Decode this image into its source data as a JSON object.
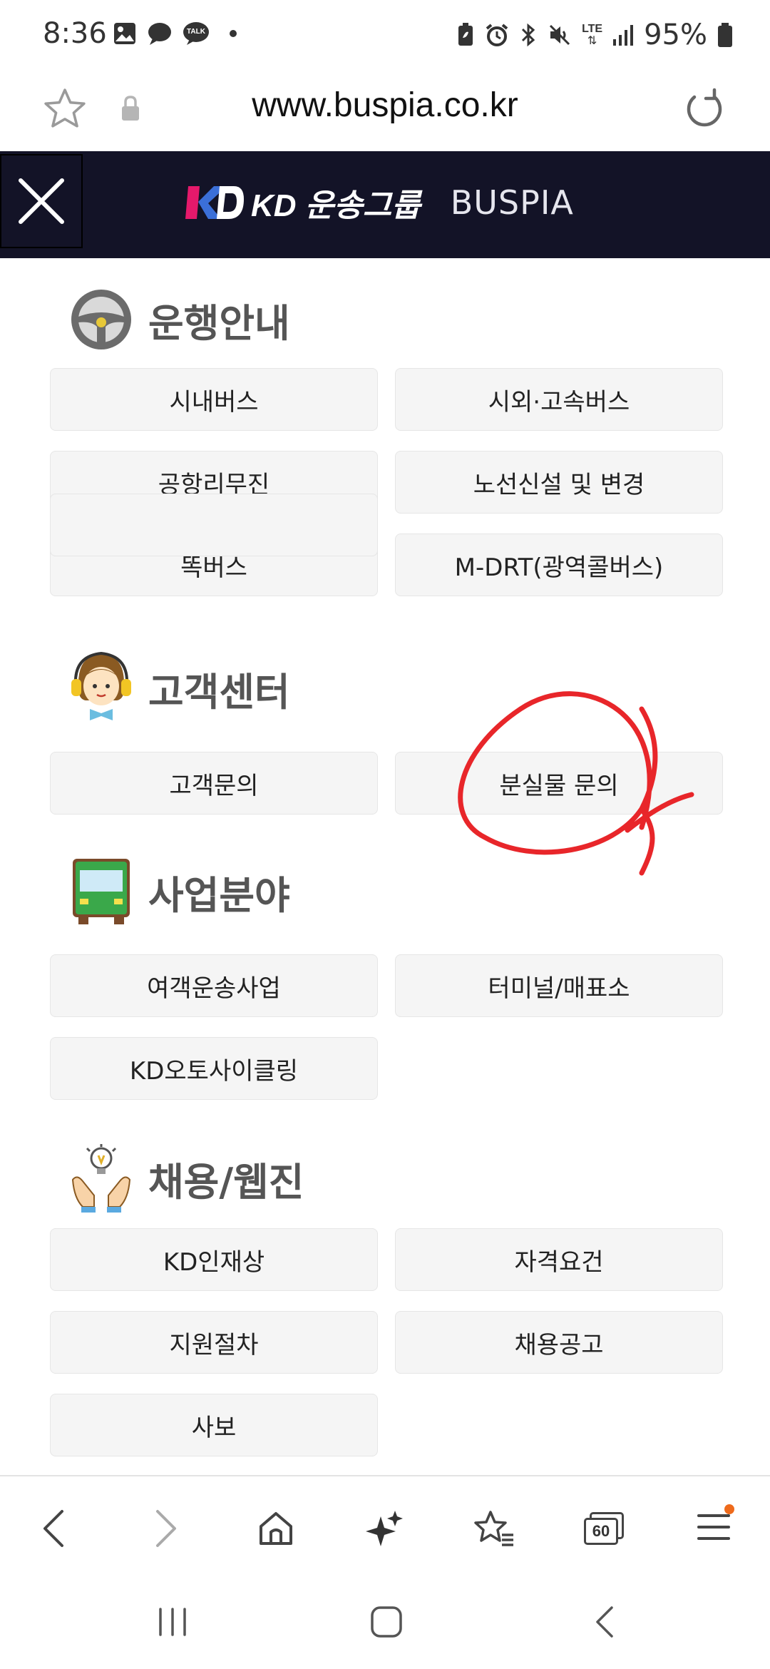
{
  "status_bar": {
    "time": "8:36",
    "talk_badge": "TALK",
    "network": "LTE",
    "battery": "95%"
  },
  "url_bar": {
    "url": "www.buspia.co.kr"
  },
  "header": {
    "logo_text": "KD 운송그룹",
    "logo_sub": "BUSPIA",
    "background": "#131327"
  },
  "sections": {
    "operation": {
      "title": "운행안내",
      "buttons": [
        "시내버스",
        "시외·고속버스",
        "공항리무진",
        "노선신설 및 변경",
        "똑버스",
        "M-DRT(광역콜버스)"
      ]
    },
    "customer": {
      "title": "고객센터",
      "buttons": [
        "고객문의",
        "분실물 문의"
      ]
    },
    "business": {
      "title": "사업분야",
      "buttons": [
        "여객운송사업",
        "터미널/매표소",
        "KD오토사이클링"
      ]
    },
    "recruit": {
      "title": "채용/웹진",
      "buttons": [
        "KD인재상",
        "자격요건",
        "지원절차",
        "채용공고",
        "사보"
      ]
    }
  },
  "browser_nav": {
    "tabs_count": "60",
    "notification_color": "#ee6a1b"
  },
  "annotation": {
    "color": "#e8262a"
  }
}
